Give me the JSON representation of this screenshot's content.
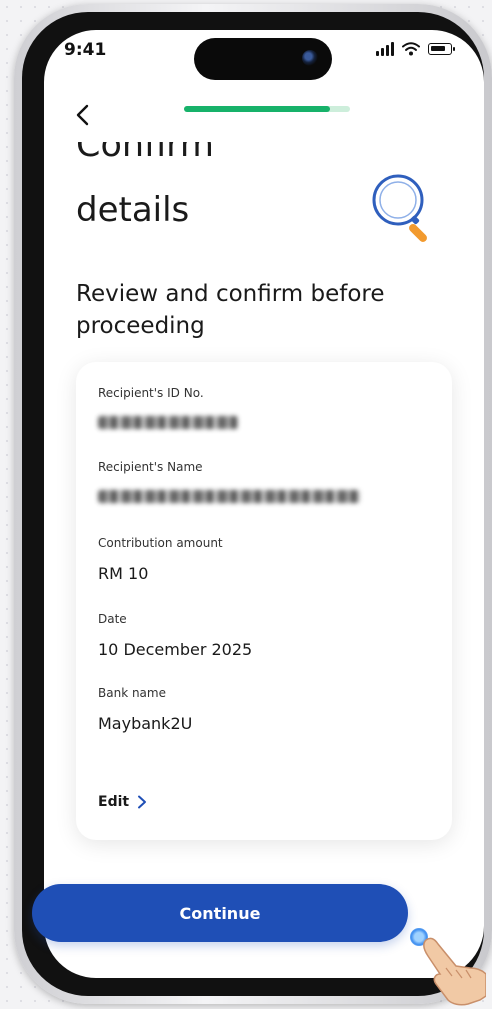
{
  "status_bar": {
    "time": "9:41"
  },
  "header": {
    "progress_percent": 88
  },
  "title": {
    "line1_cropped": "Confirm",
    "line2": "details"
  },
  "subtitle": "Review and confirm before proceeding",
  "details": {
    "recipient_id_label": "Recipient's ID No.",
    "recipient_name_label": "Recipient's Name",
    "contribution_label": "Contribution amount",
    "contribution_value": "RM 10",
    "date_label": "Date",
    "date_value": "10 December 2025",
    "bank_label": "Bank name",
    "bank_value": "Maybank2U",
    "edit_label": "Edit"
  },
  "actions": {
    "continue_label": "Continue"
  },
  "colors": {
    "accent": "#1f4fb6",
    "progress": "#17b26a",
    "progress_track": "#cdeedb",
    "icon_blue": "#2f5fbd",
    "icon_orange": "#f29a2e"
  },
  "icons": [
    "back-arrow-icon",
    "magnifier-icon",
    "signal-icon",
    "wifi-icon",
    "battery-icon",
    "chevron-right-icon",
    "hand-pointer-icon"
  ]
}
